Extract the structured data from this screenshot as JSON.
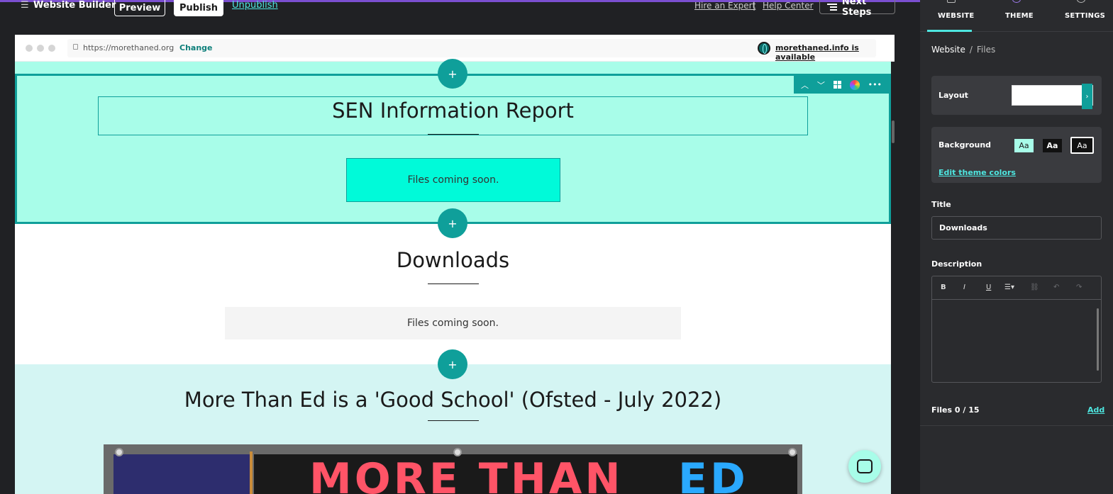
{
  "topbar": {
    "app_title": "Website Builder",
    "preview_label": "Preview",
    "publish_label": "Publish",
    "unpublish_label": "Unpublish",
    "hire_expert": "Hire an Expert",
    "separator": "|",
    "help_center": "Help Center",
    "next_steps": "Next Steps"
  },
  "browser": {
    "url": "https://morethaned.org",
    "change_label": "Change",
    "domain_available": "morethaned.info is available"
  },
  "sections": {
    "sen": {
      "title": "SEN Information Report",
      "files_text": "Files coming soon."
    },
    "downloads": {
      "title": "Downloads",
      "files_text": "Files coming soon."
    },
    "ofsted": {
      "title": "More Than Ed is a 'Good School' (Ofsted - July 2022)",
      "banner_word1": "MORE THAN",
      "banner_word2": "ED"
    },
    "add_section_symbol": "+"
  },
  "panel": {
    "tabs": [
      "WEBSITE",
      "THEME",
      "SETTINGS"
    ],
    "active_tab": "WEBSITE",
    "breadcrumb_root": "Website",
    "breadcrumb_sep": "/",
    "breadcrumb_current": "Files",
    "layout_label": "Layout",
    "background_label": "Background",
    "bg_swatch_label": "Aa",
    "edit_theme_colors": "Edit theme colors",
    "title_label": "Title",
    "title_value": "Downloads",
    "description_label": "Description",
    "rte": {
      "bold": "B",
      "italic": "I",
      "underline": "U",
      "list": "☰▾",
      "link": "⛓",
      "undo": "↶",
      "redo": "↷"
    },
    "files_count": "Files 0 / 15",
    "add_label": "Add"
  },
  "colors": {
    "accent": "#0f9f9a",
    "link": "#4ee6e0",
    "sec1_bg": "#a8fde9",
    "sec3_bg": "#d4f5f3",
    "panel_bg": "#2a2b2e"
  },
  "icons": {
    "menu": "menu-icon",
    "lock": "lock-icon",
    "globe": "globe-icon",
    "chat": "chat-icon"
  }
}
